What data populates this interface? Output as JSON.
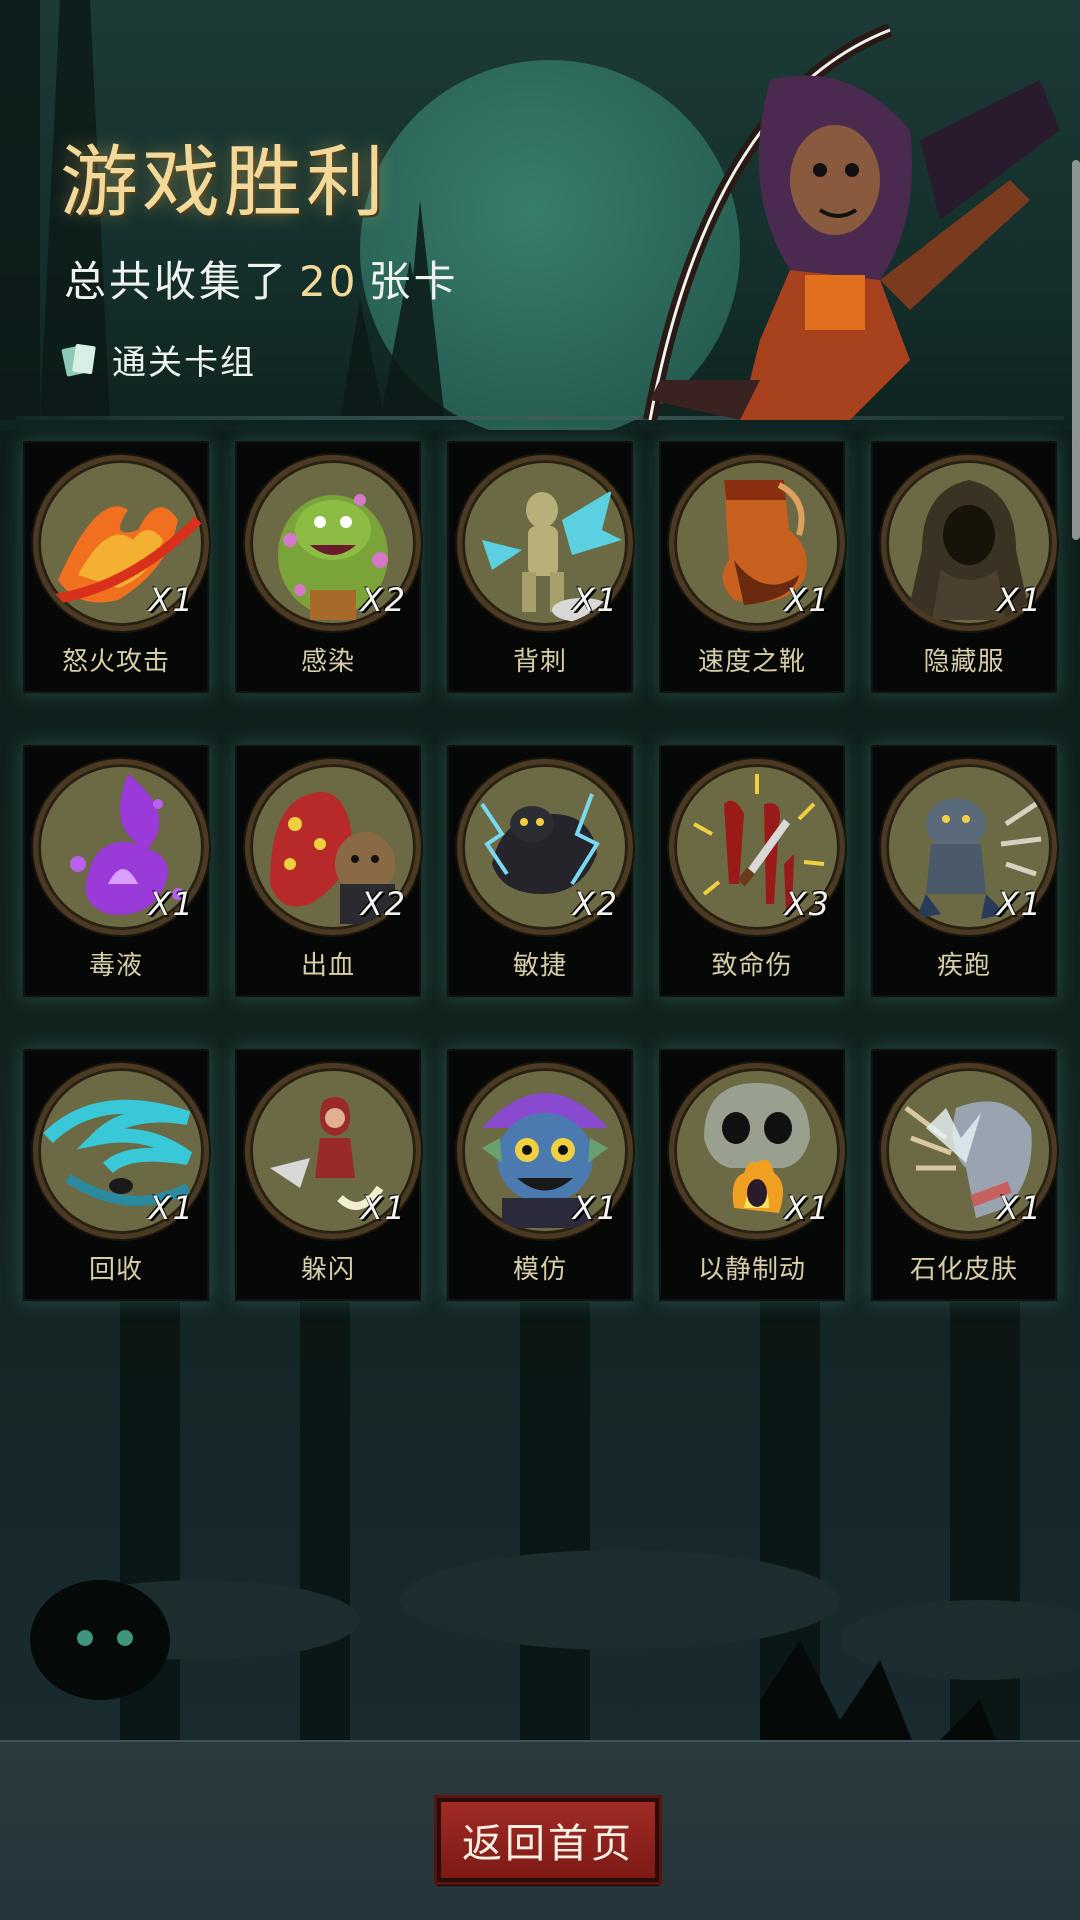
{
  "header": {
    "title": "游戏胜利",
    "collected_prefix": "总共收集了",
    "collected_count": "20",
    "collected_suffix": "张卡",
    "deck_link": "通关卡组"
  },
  "cards": [
    {
      "name": "怒火攻击",
      "count": "X1",
      "icon": "fire-slash-icon"
    },
    {
      "name": "感染",
      "count": "X2",
      "icon": "infected-monster-icon"
    },
    {
      "name": "背刺",
      "count": "X1",
      "icon": "backstab-icon"
    },
    {
      "name": "速度之靴",
      "count": "X1",
      "icon": "boot-icon"
    },
    {
      "name": "隐藏服",
      "count": "X1",
      "icon": "hooded-cloak-icon"
    },
    {
      "name": "毒液",
      "count": "X1",
      "icon": "venom-splash-icon"
    },
    {
      "name": "出血",
      "count": "X2",
      "icon": "bleeding-monster-icon"
    },
    {
      "name": "敏捷",
      "count": "X2",
      "icon": "panther-icon"
    },
    {
      "name": "致命伤",
      "count": "X3",
      "icon": "dagger-blood-icon"
    },
    {
      "name": "疾跑",
      "count": "X1",
      "icon": "running-wolf-icon"
    },
    {
      "name": "回收",
      "count": "X1",
      "icon": "whirlwind-icon"
    },
    {
      "name": "躲闪",
      "count": "X1",
      "icon": "dodge-icon"
    },
    {
      "name": "模仿",
      "count": "X1",
      "icon": "goblin-mask-icon"
    },
    {
      "name": "以静制动",
      "count": "X1",
      "icon": "skull-fire-icon"
    },
    {
      "name": "石化皮肤",
      "count": "X1",
      "icon": "stone-arm-icon"
    }
  ],
  "footer": {
    "home_button": "返回首页"
  },
  "colors": {
    "title_gold": "#f2d99a",
    "card_name": "#d9cda8",
    "button_red": "#a12a24"
  }
}
